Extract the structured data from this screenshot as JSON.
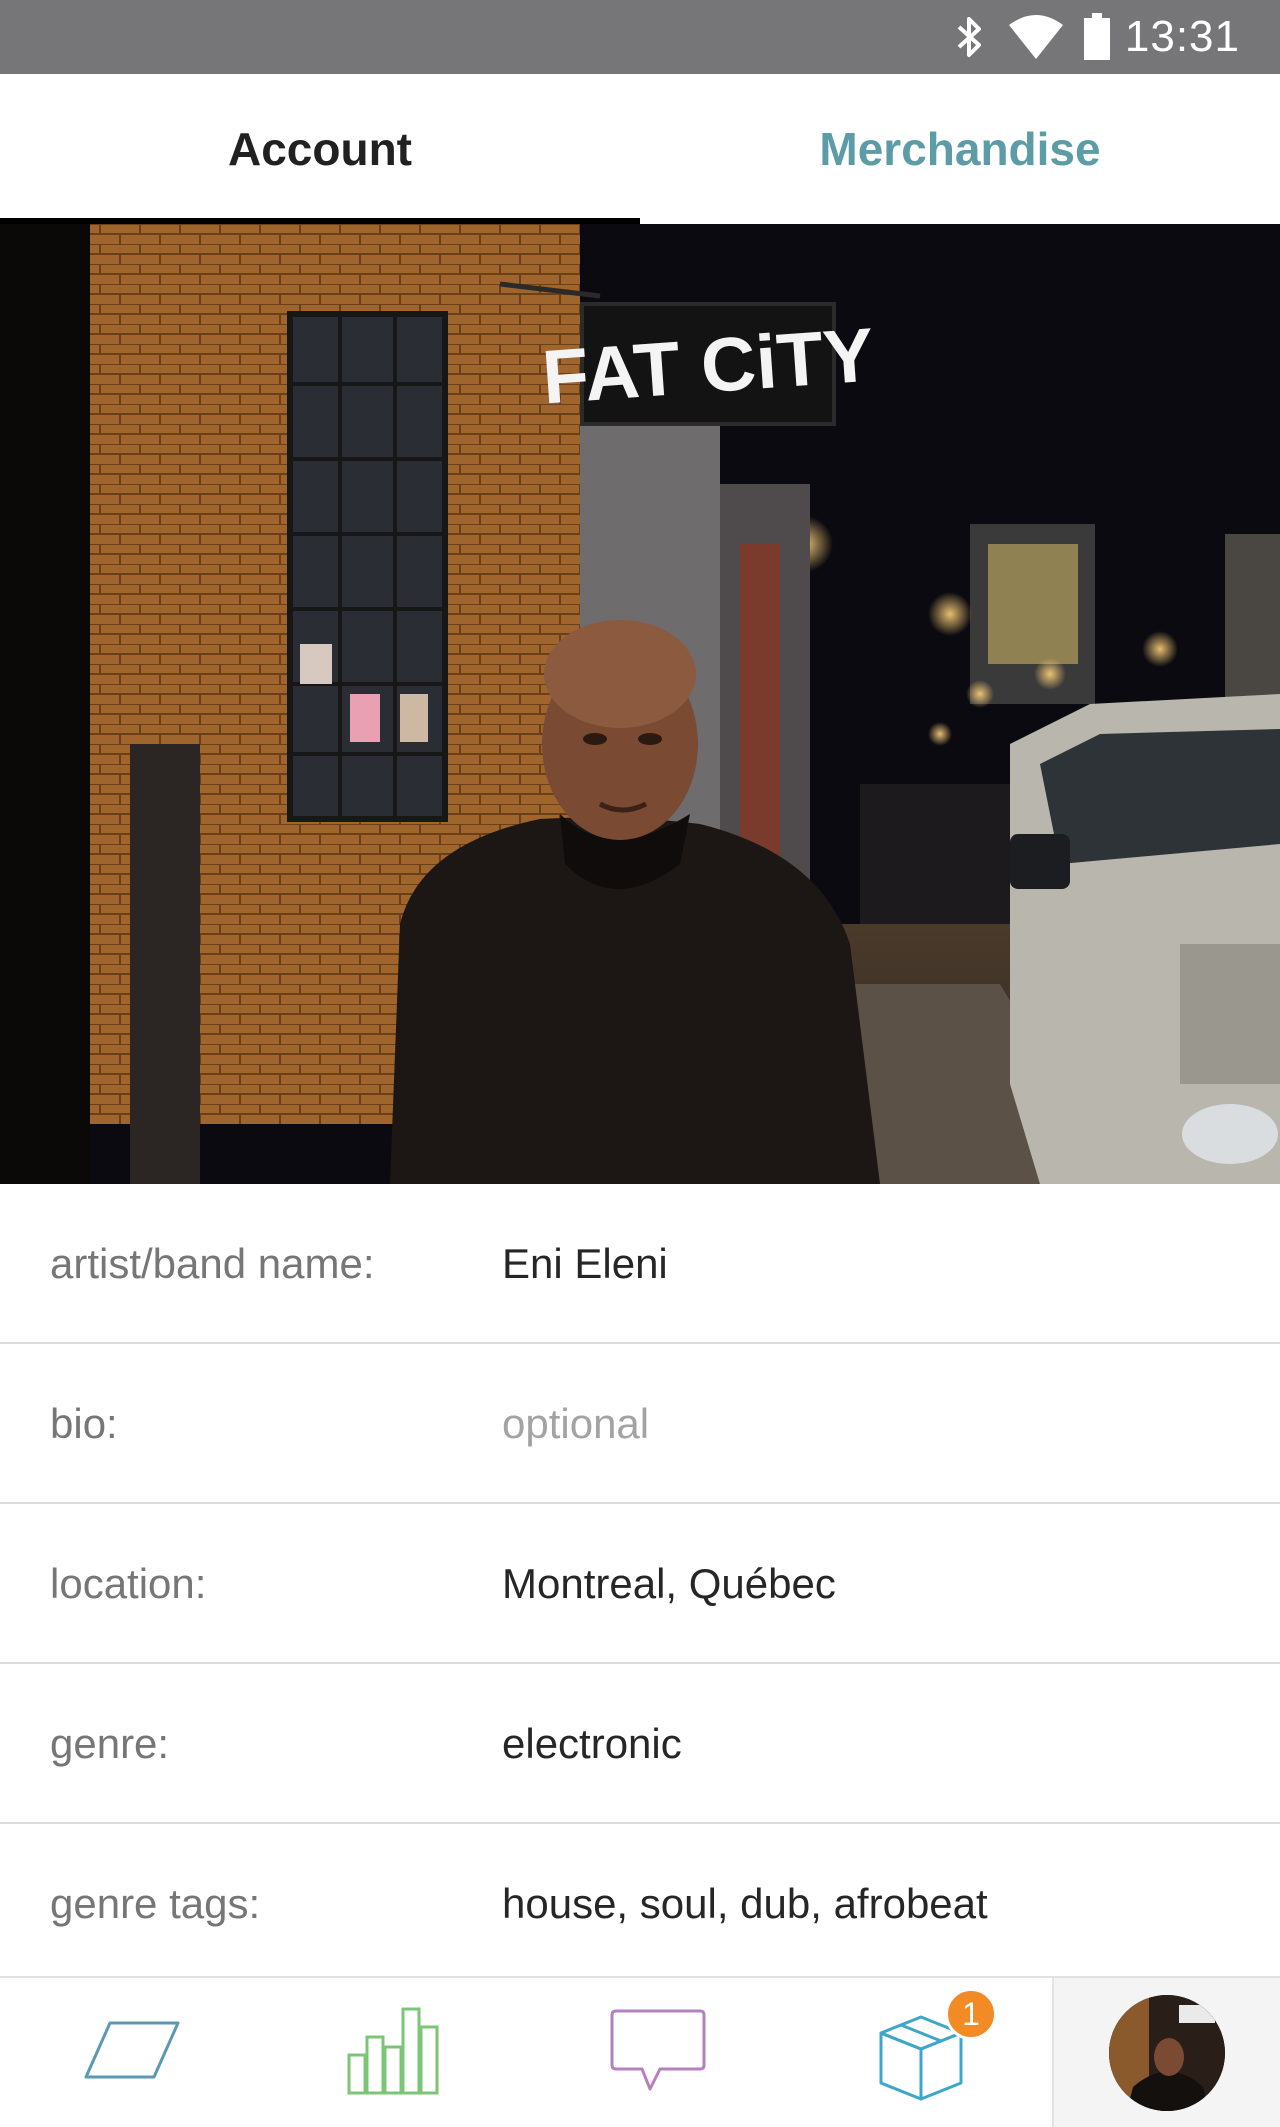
{
  "status_bar": {
    "time": "13:31",
    "icons": [
      "bluetooth-icon",
      "wifi-icon",
      "battery-icon"
    ]
  },
  "tabs": [
    {
      "label": "Account",
      "active": true
    },
    {
      "label": "Merchandise",
      "active": false
    }
  ],
  "photo": {
    "sign_text": "FAT CiTY"
  },
  "form": {
    "rows": [
      {
        "label": "artist/band name:",
        "value": "Eni Eleni"
      },
      {
        "label": "bio:",
        "placeholder": "optional"
      },
      {
        "label": "location:",
        "value": "Montreal, Québec"
      },
      {
        "label": "genre:",
        "value": "electronic"
      },
      {
        "label": "genre tags:",
        "value": "house, soul, dub, afrobeat"
      }
    ]
  },
  "bottom_nav": {
    "items": [
      {
        "name": "feed",
        "icon": "parallelogram-icon",
        "color": "#5a98b5"
      },
      {
        "name": "stats",
        "icon": "bar-chart-icon",
        "color": "#7cc576"
      },
      {
        "name": "messages",
        "icon": "chat-bubble-icon",
        "color": "#b480be"
      },
      {
        "name": "orders",
        "icon": "package-box-icon",
        "color": "#3ea7c9",
        "badge": "1"
      },
      {
        "name": "profile",
        "icon": "avatar-icon"
      }
    ],
    "badge_color": "#f28a25"
  },
  "colors": {
    "status_bar": "#767577",
    "accent": "#5c9ca6",
    "active_tab_text": "#212121",
    "label_text": "#767676",
    "value_text": "#262626",
    "placeholder_text": "#a3a3a3"
  }
}
